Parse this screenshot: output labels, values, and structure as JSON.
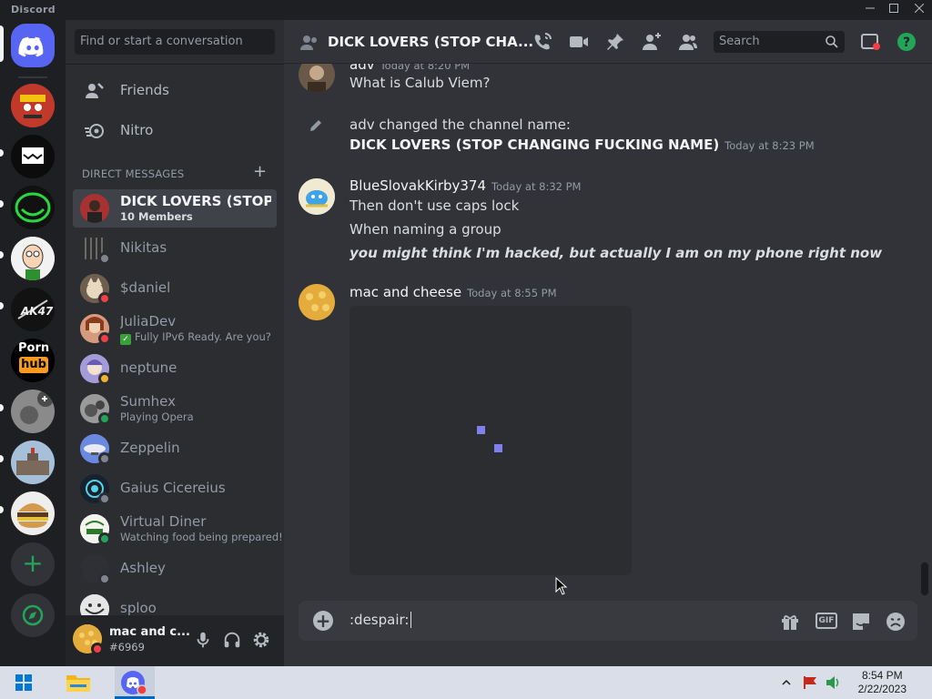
{
  "window": {
    "app_name": "Discord",
    "controls": [
      "minimize",
      "maximize",
      "close"
    ]
  },
  "colors": {
    "blurple": "#5865f2",
    "green": "#23a559",
    "red_status": "#f23f43",
    "idle": "#f0b232",
    "background_main": "#313338",
    "background_side": "#2b2d31"
  },
  "servers": [
    {
      "name": "Direct Messages",
      "icon": "discord-logo-icon"
    },
    {
      "name": "server-1",
      "icon": "red-cartoon-face-icon"
    },
    {
      "name": "server-2",
      "icon": "white-monster-icon"
    },
    {
      "name": "server-3",
      "icon": "trollface-green-icon"
    },
    {
      "name": "server-4",
      "icon": "cartoon-man-icon"
    },
    {
      "name": "server-5",
      "icon": "ak47-logo-icon"
    },
    {
      "name": "server-6",
      "icon": "hub-logo-icon",
      "logo_text_top": "Porn",
      "logo_text_bottom": "hub"
    },
    {
      "name": "server-7",
      "icon": "grey-photo-icon"
    },
    {
      "name": "server-8",
      "icon": "building-photo-icon"
    },
    {
      "name": "server-9",
      "icon": "burger-photo-icon"
    },
    {
      "name": "add-server",
      "icon": "plus-icon"
    },
    {
      "name": "explore",
      "icon": "compass-icon"
    }
  ],
  "dm_panel": {
    "search_placeholder": "Find or start a conversation",
    "nav": [
      {
        "label": "Friends",
        "icon": "friends-icon"
      },
      {
        "label": "Nitro",
        "icon": "nitro-icon"
      }
    ],
    "header": "DIRECT MESSAGES",
    "dms": [
      {
        "name": "DICK LOVERS (STOP ...",
        "sub": "10 Members",
        "status": "none",
        "active": true
      },
      {
        "name": "Nikitas",
        "sub": "",
        "status": "offline"
      },
      {
        "name": "$daniel",
        "sub": "",
        "status": "dnd"
      },
      {
        "name": "JuliaDev",
        "sub": "Fully IPv6 Ready. Are you?",
        "sub_icon": "checkmark-emoji-icon",
        "status": "dnd"
      },
      {
        "name": "neptune",
        "sub": "",
        "status": "idle"
      },
      {
        "name": "Sumhex",
        "sub": "Playing Opera",
        "status": "online"
      },
      {
        "name": "Zeppelin",
        "sub": "",
        "status": "offline"
      },
      {
        "name": "Gaius Cicereius",
        "sub": "",
        "status": "offline"
      },
      {
        "name": "Virtual Diner",
        "sub": "Watching food being prepared!",
        "status": "online"
      },
      {
        "name": "Ashley",
        "sub": "",
        "status": "offline"
      },
      {
        "name": "sploo",
        "sub": "",
        "status": "offline"
      }
    ]
  },
  "user_panel": {
    "username": "mac and c...",
    "tag": "#6969",
    "status": "dnd",
    "buttons": [
      "microphone-icon",
      "headphones-icon",
      "settings-gear-icon"
    ]
  },
  "channel": {
    "title": "DICK LOVERS (STOP CHA...",
    "search_placeholder": "Search",
    "header_buttons": [
      "start-voice-call-icon",
      "start-video-call-icon",
      "pinned-messages-icon",
      "add-friends-to-dm-icon",
      "member-list-icon",
      "inbox-icon",
      "help-icon"
    ]
  },
  "messages": [
    {
      "author": "adv",
      "time": "Today at 8:20 PM",
      "lines": [
        "What is Calub Viem?"
      ]
    },
    {
      "system": true,
      "text": "adv changed the channel name:",
      "new_name": "DICK LOVERS (STOP CHANGING FUCKING NAME)",
      "time": "Today at 8:23 PM"
    },
    {
      "author": "BlueSlovakKirby374",
      "time": "Today at 8:32 PM",
      "lines": [
        "Then don't use caps lock",
        "When naming a group",
        "you might think I'm hacked, but actually I am on my phone right now"
      ]
    },
    {
      "author": "mac and cheese",
      "time": "Today at 8:55 PM",
      "attachment": "loading-image-placeholder"
    }
  ],
  "composer": {
    "value": ":despair:",
    "buttons": [
      "gift-icon",
      "gif-icon",
      "sticker-icon",
      "emoji-icon"
    ],
    "gif_label": "GIF"
  },
  "taskbar": {
    "apps": [
      "windows-start-icon",
      "file-explorer-icon",
      "discord-taskbar-icon"
    ],
    "time": "8:54 PM",
    "date": "2/22/2023"
  }
}
